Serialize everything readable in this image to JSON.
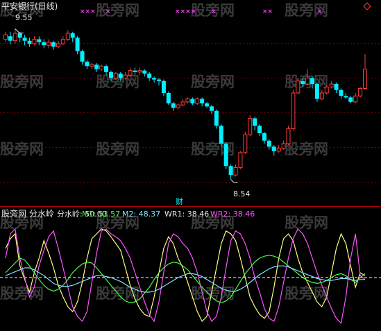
{
  "watermark_text": "股旁网",
  "colors": {
    "up": "#ff3c3c",
    "down": "#00f0ff",
    "grid": "#7a0000",
    "divider": "#b00000",
    "wr1": "#ffff80",
    "wr2": "#ff55ff",
    "m1": "#44ff44",
    "m2": "#80e0ff",
    "midline": "#ffffff"
  },
  "upper": {
    "title": "平安银行(日线)",
    "high_label": "9.55",
    "low_label": "8.54",
    "event_label": "财",
    "top_markers": [
      "×××",
      "×",
      "××××",
      "×",
      "××",
      "×"
    ]
  },
  "lower": {
    "title": "股旁网 分水岭",
    "indicators": [
      {
        "key": "fsl",
        "text": "分水岭: 50.00",
        "color": "#e6e6e6"
      },
      {
        "key": "m1",
        "text": "M1: 53.57",
        "color": "#44ff44"
      },
      {
        "key": "m2",
        "text": "M2: 48.37",
        "color": "#80e0ff"
      },
      {
        "key": "wr1",
        "text": "WR1: 38.46",
        "color": "#e6e6e6"
      },
      {
        "key": "wr2",
        "text": "WR2: 38.46",
        "color": "#ff55ff"
      }
    ]
  },
  "chart_data": [
    {
      "type": "candlestick",
      "title": "平安银行(日线)",
      "ylim": [
        8.45,
        9.65
      ],
      "high_annotation": 9.55,
      "low_annotation": 8.54,
      "candles": [
        [
          9.48,
          9.51,
          9.53,
          9.46
        ],
        [
          9.5,
          9.47,
          9.53,
          9.45
        ],
        [
          9.47,
          9.52,
          9.55,
          9.45
        ],
        [
          9.52,
          9.49,
          9.53,
          9.46
        ],
        [
          9.49,
          9.47,
          9.51,
          9.44
        ],
        [
          9.47,
          9.45,
          9.49,
          9.43
        ],
        [
          9.45,
          9.48,
          9.5,
          9.44
        ],
        [
          9.48,
          9.46,
          9.5,
          9.44
        ],
        [
          9.46,
          9.44,
          9.48,
          9.42
        ],
        [
          9.44,
          9.46,
          9.48,
          9.42
        ],
        [
          9.46,
          9.43,
          9.47,
          9.41
        ],
        [
          9.43,
          9.45,
          9.47,
          9.42
        ],
        [
          9.45,
          9.48,
          9.5,
          9.44
        ],
        [
          9.48,
          9.52,
          9.54,
          9.47
        ],
        [
          9.52,
          9.49,
          9.53,
          9.46
        ],
        [
          9.49,
          9.4,
          9.5,
          9.38
        ],
        [
          9.4,
          9.33,
          9.41,
          9.31
        ],
        [
          9.33,
          9.3,
          9.34,
          9.28
        ],
        [
          9.3,
          9.31,
          9.32,
          9.28
        ],
        [
          9.31,
          9.28,
          9.32,
          9.26
        ],
        [
          9.28,
          9.3,
          9.31,
          9.27
        ],
        [
          9.3,
          9.26,
          9.31,
          9.24
        ],
        [
          9.26,
          9.22,
          9.27,
          9.2
        ],
        [
          9.22,
          9.25,
          9.26,
          9.21
        ],
        [
          9.25,
          9.22,
          9.26,
          9.2
        ],
        [
          9.22,
          9.24,
          9.26,
          9.21
        ],
        [
          9.24,
          9.27,
          9.29,
          9.23
        ],
        [
          9.27,
          9.26,
          9.29,
          9.24
        ],
        [
          9.26,
          9.27,
          9.29,
          9.24
        ],
        [
          9.27,
          9.25,
          9.28,
          9.23
        ],
        [
          9.25,
          9.22,
          9.26,
          9.2
        ],
        [
          9.22,
          9.21,
          9.23,
          9.19
        ],
        [
          9.21,
          9.2,
          9.22,
          9.17
        ],
        [
          9.2,
          9.12,
          9.21,
          9.1
        ],
        [
          9.12,
          9.05,
          9.13,
          9.04
        ],
        [
          9.05,
          9.02,
          9.06,
          9.0
        ],
        [
          9.02,
          9.04,
          9.05,
          9.01
        ],
        [
          9.04,
          9.06,
          9.08,
          9.03
        ],
        [
          9.06,
          9.08,
          9.09,
          9.05
        ],
        [
          9.08,
          9.05,
          9.09,
          9.04
        ],
        [
          9.05,
          9.08,
          9.09,
          9.04
        ],
        [
          9.08,
          9.05,
          9.09,
          9.03
        ],
        [
          9.05,
          9.03,
          9.06,
          9.02
        ],
        [
          9.03,
          9.0,
          9.04,
          8.98
        ],
        [
          9.0,
          8.9,
          9.01,
          8.88
        ],
        [
          8.9,
          8.78,
          8.91,
          8.76
        ],
        [
          8.78,
          8.63,
          8.79,
          8.61
        ],
        [
          8.63,
          8.57,
          8.64,
          8.54
        ],
        [
          8.57,
          8.62,
          8.64,
          8.56
        ],
        [
          8.62,
          8.72,
          8.73,
          8.61
        ],
        [
          8.72,
          8.84,
          8.86,
          8.71
        ],
        [
          8.84,
          8.95,
          8.97,
          8.83
        ],
        [
          8.95,
          8.9,
          8.96,
          8.87
        ],
        [
          8.9,
          8.85,
          8.91,
          8.83
        ],
        [
          8.85,
          8.8,
          8.86,
          8.78
        ],
        [
          8.8,
          8.76,
          8.81,
          8.74
        ],
        [
          8.76,
          8.73,
          8.77,
          8.7
        ],
        [
          8.73,
          8.75,
          8.77,
          8.72
        ],
        [
          8.75,
          8.78,
          8.8,
          8.74
        ],
        [
          8.78,
          8.88,
          8.9,
          8.77
        ],
        [
          8.88,
          9.12,
          9.14,
          8.87
        ],
        [
          9.12,
          9.2,
          9.22,
          9.11
        ],
        [
          9.2,
          9.18,
          9.22,
          9.16
        ],
        [
          9.18,
          9.22,
          9.28,
          9.17
        ],
        [
          9.22,
          9.18,
          9.23,
          9.15
        ],
        [
          9.18,
          9.08,
          9.19,
          9.06
        ],
        [
          9.08,
          9.12,
          9.14,
          9.07
        ],
        [
          9.12,
          9.16,
          9.17,
          9.11
        ],
        [
          9.16,
          9.18,
          9.2,
          9.15
        ],
        [
          9.18,
          9.14,
          9.19,
          9.12
        ],
        [
          9.14,
          9.1,
          9.15,
          9.08
        ],
        [
          9.1,
          9.09,
          9.12,
          9.08
        ],
        [
          9.09,
          9.06,
          9.1,
          9.05
        ],
        [
          9.06,
          9.1,
          9.12,
          9.05
        ],
        [
          9.1,
          9.15,
          9.16,
          9.09
        ],
        [
          9.15,
          9.28,
          9.38,
          9.14
        ]
      ]
    },
    {
      "type": "line",
      "title": "股旁网 分水岭",
      "ylim": [
        0,
        100
      ],
      "reference_line": 50,
      "x_count": 76,
      "series": [
        {
          "name": "WR1",
          "values": [
            80,
            90,
            95,
            62,
            48,
            35,
            55,
            70,
            88,
            75,
            60,
            42,
            30,
            20,
            15,
            25,
            45,
            70,
            90,
            95,
            100,
            98,
            92,
            85,
            78,
            60,
            42,
            28,
            18,
            12,
            10,
            30,
            55,
            80,
            92,
            85,
            70,
            60,
            45,
            30,
            15,
            5,
            10,
            35,
            60,
            85,
            98,
            95,
            88,
            70,
            50,
            30,
            20,
            12,
            8,
            15,
            40,
            70,
            90,
            95,
            88,
            70,
            55,
            45,
            35,
            25,
            20,
            30,
            55,
            80,
            95,
            85,
            62,
            40,
            55,
            52
          ]
        },
        {
          "name": "WR2",
          "values": [
            70,
            95,
            100,
            70,
            50,
            30,
            40,
            62,
            78,
            92,
            98,
            80,
            60,
            40,
            20,
            10,
            5,
            15,
            45,
            75,
            98,
            100,
            95,
            92,
            88,
            80,
            70,
            55,
            40,
            25,
            12,
            5,
            25,
            55,
            85,
            95,
            92,
            85,
            80,
            70,
            55,
            35,
            15,
            5,
            10,
            30,
            60,
            88,
            98,
            95,
            85,
            70,
            50,
            35,
            18,
            8,
            5,
            20,
            45,
            70,
            90,
            100,
            95,
            85,
            70,
            55,
            42,
            30,
            18,
            8,
            3,
            30,
            70,
            95,
            52,
            48
          ]
        },
        {
          "name": "M1",
          "values": [
            55,
            60,
            65,
            70,
            68,
            62,
            55,
            48,
            42,
            38,
            36,
            38,
            42,
            48,
            55,
            60,
            64,
            66,
            65,
            60,
            54,
            48,
            42,
            36,
            30,
            26,
            24,
            25,
            28,
            34,
            40,
            48,
            55,
            60,
            64,
            66,
            65,
            62,
            58,
            52,
            46,
            40,
            35,
            30,
            26,
            24,
            26,
            30,
            38,
            46,
            54,
            60,
            66,
            70,
            72,
            73,
            72,
            70,
            66,
            62,
            58,
            54,
            50,
            47,
            45,
            44,
            45,
            47,
            50,
            53,
            54,
            52,
            48,
            45,
            50,
            54
          ]
        },
        {
          "name": "M2",
          "values": [
            52,
            54,
            56,
            58,
            60,
            60,
            58,
            55,
            52,
            48,
            44,
            42,
            41,
            41,
            42,
            44,
            46,
            48,
            50,
            52,
            52,
            51,
            50,
            48,
            46,
            43,
            40,
            38,
            36,
            35,
            35,
            36,
            38,
            41,
            44,
            47,
            50,
            52,
            54,
            54,
            53,
            51,
            48,
            45,
            42,
            39,
            37,
            36,
            36,
            38,
            41,
            45,
            49,
            53,
            56,
            59,
            61,
            62,
            62,
            61,
            59,
            57,
            55,
            53,
            51,
            49,
            48,
            47,
            47,
            48,
            49,
            49,
            48,
            47,
            48,
            48
          ]
        }
      ]
    }
  ]
}
